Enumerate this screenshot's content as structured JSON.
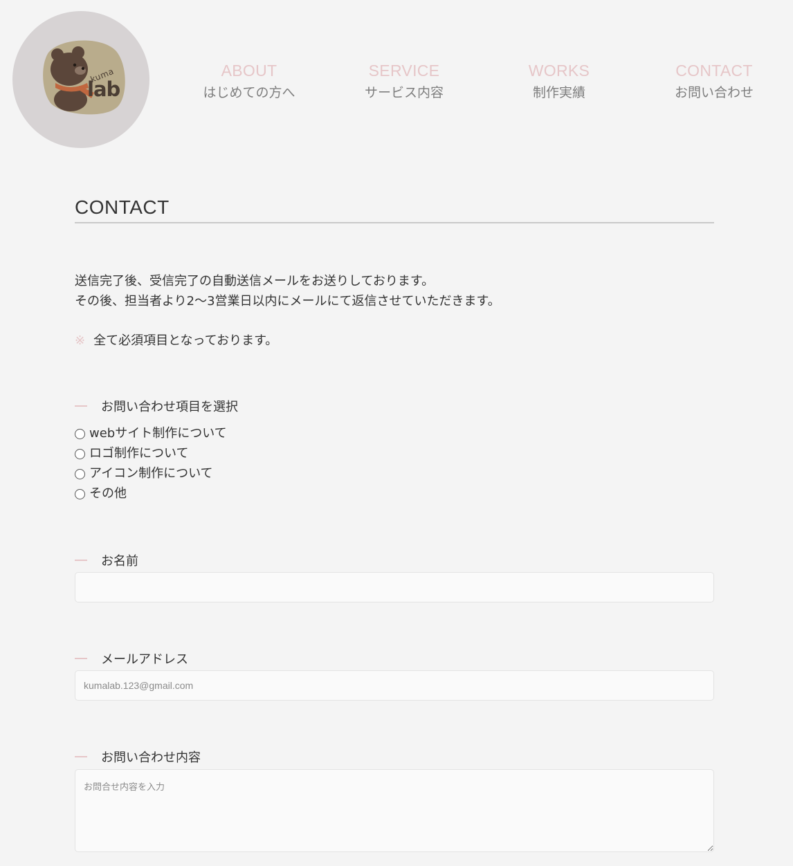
{
  "logo": {
    "small_text": "kuma",
    "large_text": "lab"
  },
  "nav": [
    {
      "en": "ABOUT",
      "ja": "はじめての方へ"
    },
    {
      "en": "SERVICE",
      "ja": "サービス内容"
    },
    {
      "en": "WORKS",
      "ja": "制作実績"
    },
    {
      "en": "CONTACT",
      "ja": "お問い合わせ"
    }
  ],
  "page": {
    "title": "CONTACT",
    "intro": [
      "送信完了後、受信完了の自動送信メールをお送りしております。",
      "その後、担当者より2〜3営業日以内にメールにて返信させていただきます。"
    ],
    "note_mark": "※",
    "note": "全て必須項目となっております。"
  },
  "form": {
    "inquiry_type": {
      "label": "お問い合わせ項目を選択",
      "options": [
        "webサイト制作について",
        "ロゴ制作について",
        "アイコン制作について",
        "その他"
      ]
    },
    "name": {
      "label": "お名前",
      "placeholder": "",
      "value": ""
    },
    "email": {
      "label": "メールアドレス",
      "placeholder": "kumalab.123@gmail.com",
      "value": ""
    },
    "message": {
      "label": "お問い合わせ内容",
      "placeholder": "お問合せ内容を入力",
      "value": ""
    }
  },
  "colors": {
    "accent": "#e6c6c8",
    "background": "#f4f4f4",
    "logo_bg": "#d7d3d4"
  }
}
